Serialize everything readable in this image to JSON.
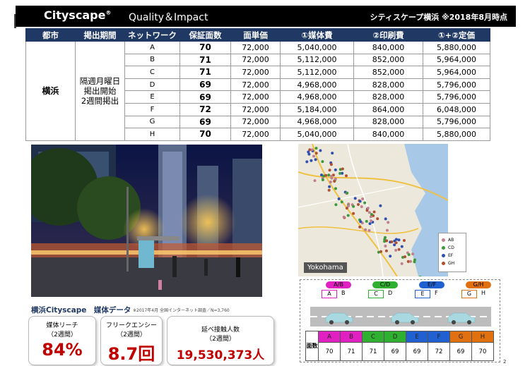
{
  "header": {
    "brand": "Cityscape",
    "brand_mark": "®",
    "tagline": "Quality＆Impact",
    "meta": "シティスケープ横浜 ※2018年8月時点"
  },
  "table": {
    "columns": [
      "都市",
      "掲出期間",
      "ネットワーク",
      "保証面数",
      "面単価",
      "①媒体費",
      "②印刷費",
      "①+②定価"
    ],
    "city": "横浜",
    "period": [
      "隔週月曜日",
      "掲出開始",
      "2週間掲出"
    ],
    "rows": [
      {
        "network": "A",
        "faces": "70",
        "unit": "72,000",
        "media": "5,040,000",
        "print": "840,000",
        "total": "5,880,000"
      },
      {
        "network": "B",
        "faces": "71",
        "unit": "72,000",
        "media": "5,112,000",
        "print": "852,000",
        "total": "5,964,000"
      },
      {
        "network": "C",
        "faces": "71",
        "unit": "72,000",
        "media": "5,112,000",
        "print": "852,000",
        "total": "5,964,000"
      },
      {
        "network": "D",
        "faces": "69",
        "unit": "72,000",
        "media": "4,968,000",
        "print": "828,000",
        "total": "5,796,000"
      },
      {
        "network": "E",
        "faces": "69",
        "unit": "72,000",
        "media": "4,968,000",
        "print": "828,000",
        "total": "5,796,000"
      },
      {
        "network": "F",
        "faces": "72",
        "unit": "72,000",
        "media": "5,184,000",
        "print": "864,000",
        "total": "6,048,000"
      },
      {
        "network": "G",
        "faces": "69",
        "unit": "72,000",
        "media": "4,968,000",
        "print": "828,000",
        "total": "5,796,000"
      },
      {
        "network": "H",
        "faces": "70",
        "unit": "72,000",
        "media": "5,040,000",
        "print": "840,000",
        "total": "5,880,000"
      }
    ]
  },
  "media": {
    "title": "横浜Cityscape　媒体データ",
    "note": "※2017年4月 全国インターネット調査／N=3,760",
    "cards": [
      {
        "line1": "媒体リーチ",
        "line2": "（2週間）",
        "value": "84%"
      },
      {
        "line1": "フリークエンシー",
        "line2": "（2週間）",
        "value": "8.7回"
      },
      {
        "line1": "延べ接触人数",
        "line2": "（2週間）",
        "value": "19,530,373人"
      }
    ]
  },
  "map": {
    "label": "Yokohama",
    "legend": [
      {
        "label": "AB",
        "color": "#c08090"
      },
      {
        "label": "CD",
        "color": "#3a9a3a"
      },
      {
        "label": "EF",
        "color": "#3050b0"
      },
      {
        "label": "GH",
        "color": "#b05030"
      }
    ]
  },
  "diagram": {
    "pairs": [
      {
        "label": "A/B",
        "color": "#e020c0",
        "left": "A",
        "right": "B"
      },
      {
        "label": "C/D",
        "color": "#30b030",
        "left": "C",
        "right": "D"
      },
      {
        "label": "E/F",
        "color": "#2060d0",
        "left": "E",
        "right": "F"
      },
      {
        "label": "G/H",
        "color": "#e07010",
        "left": "G",
        "right": "H"
      }
    ],
    "header_label": "面数",
    "cells": [
      {
        "letter": "A",
        "count": "70",
        "color": "#e020c0"
      },
      {
        "letter": "B",
        "count": "71",
        "color": "#e020c0"
      },
      {
        "letter": "C",
        "count": "71",
        "color": "#30b030"
      },
      {
        "letter": "D",
        "count": "69",
        "color": "#30b030"
      },
      {
        "letter": "E",
        "count": "69",
        "color": "#2060d0"
      },
      {
        "letter": "F",
        "count": "72",
        "color": "#2060d0"
      },
      {
        "letter": "G",
        "count": "69",
        "color": "#e07010"
      },
      {
        "letter": "H",
        "count": "70",
        "color": "#e07010"
      }
    ]
  },
  "page_number": "2"
}
